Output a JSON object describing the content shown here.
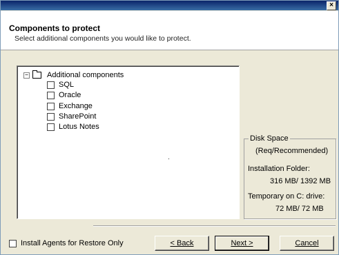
{
  "window": {
    "close_glyph": "×"
  },
  "header": {
    "title": "Components to protect",
    "subtitle": "Select additional components you would like to protect."
  },
  "tree": {
    "root_label": "Additional components",
    "expander_glyph": "−",
    "items": [
      {
        "label": "SQL",
        "checked": false
      },
      {
        "label": "Oracle",
        "checked": false
      },
      {
        "label": "Exchange",
        "checked": false
      },
      {
        "label": "SharePoint",
        "checked": false
      },
      {
        "label": "Lotus Notes",
        "checked": false
      }
    ]
  },
  "disk_space": {
    "legend": "Disk Space",
    "req_label": "(Req/Recommended)",
    "install_folder_label": "Installation Folder:",
    "install_folder_value": "316 MB/ 1392 MB",
    "temp_label": "Temporary on C: drive:",
    "temp_value": "72 MB/ 72 MB"
  },
  "footer": {
    "restore_only_label": "Install Agents for Restore Only",
    "restore_only_checked": false,
    "back_label": "< Back",
    "next_label": "Next >",
    "cancel_label": "Cancel"
  }
}
